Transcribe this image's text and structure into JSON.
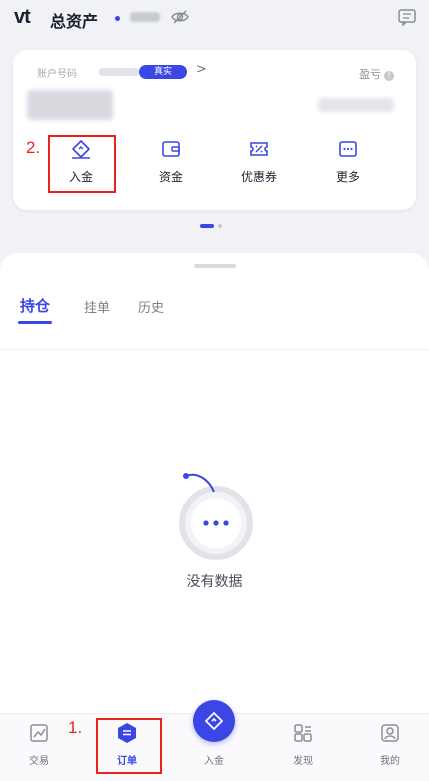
{
  "header": {
    "logo": "vt",
    "title": "总资产"
  },
  "account": {
    "label": "账户号码",
    "badge": "真实",
    "chevron": ">",
    "pnl_label": "盈亏",
    "pnl_info": "!"
  },
  "actions": [
    {
      "label": "入金",
      "icon": "deposit-icon"
    },
    {
      "label": "资金",
      "icon": "wallet-icon"
    },
    {
      "label": "优惠券",
      "icon": "coupon-icon"
    },
    {
      "label": "更多",
      "icon": "more-icon"
    }
  ],
  "tabs": [
    {
      "label": "持仓",
      "active": true
    },
    {
      "label": "挂单",
      "active": false
    },
    {
      "label": "历史",
      "active": false
    }
  ],
  "empty_state": {
    "text": "没有数据"
  },
  "bottom_nav": [
    {
      "label": "交易",
      "icon": "chart-icon",
      "active": false
    },
    {
      "label": "订单",
      "icon": "order-icon",
      "active": true
    },
    {
      "label": "入金",
      "icon": "deposit-icon",
      "active": false
    },
    {
      "label": "发现",
      "icon": "discover-icon",
      "active": false
    },
    {
      "label": "我的",
      "icon": "profile-icon",
      "active": false
    }
  ],
  "annotations": [
    {
      "label": "1."
    },
    {
      "label": "2."
    }
  ],
  "colors": {
    "accent": "#3a46e6",
    "annotation": "#e8231b",
    "background": "#f1f2f6"
  }
}
